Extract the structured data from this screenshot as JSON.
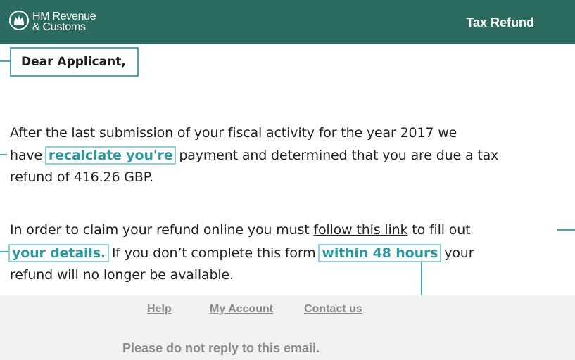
{
  "header": {
    "org_line1": "HM Revenue",
    "org_line2": "& Customs",
    "crest_icon": "crest-icon",
    "title": "Tax Refund",
    "background_color": "#2c6b61"
  },
  "email": {
    "salutation": "Dear Applicant,",
    "paragraph1": {
      "line1": "After the last submission of your fiscal activity for the year 2017 we",
      "line2_before": "have ",
      "line2_highlight": "recalclate you're",
      "line2_after": " payment and determined that you are due a tax",
      "line3": "refund of 416.26 GBP."
    },
    "paragraph2": {
      "line1_before": "In order to claim your refund online you must ",
      "link_text": "follow this link",
      "line1_after": " to fill out",
      "line2_highlight1": "your details.",
      "line2_middle": " If you don’t complete this form ",
      "line2_highlight2": "within 48 hours",
      "line2_after": " your",
      "line3": "refund will no longer be available."
    }
  },
  "footer": {
    "help": "Help",
    "my_account": "My Account",
    "contact_us": "Contact us",
    "note": "Please do not reply to this email."
  },
  "colors": {
    "accent": "#4aa8b3",
    "highlight_text": "#2c9aa0",
    "footer_bg": "#f1f1f1",
    "footer_text": "#8a8a8a"
  }
}
